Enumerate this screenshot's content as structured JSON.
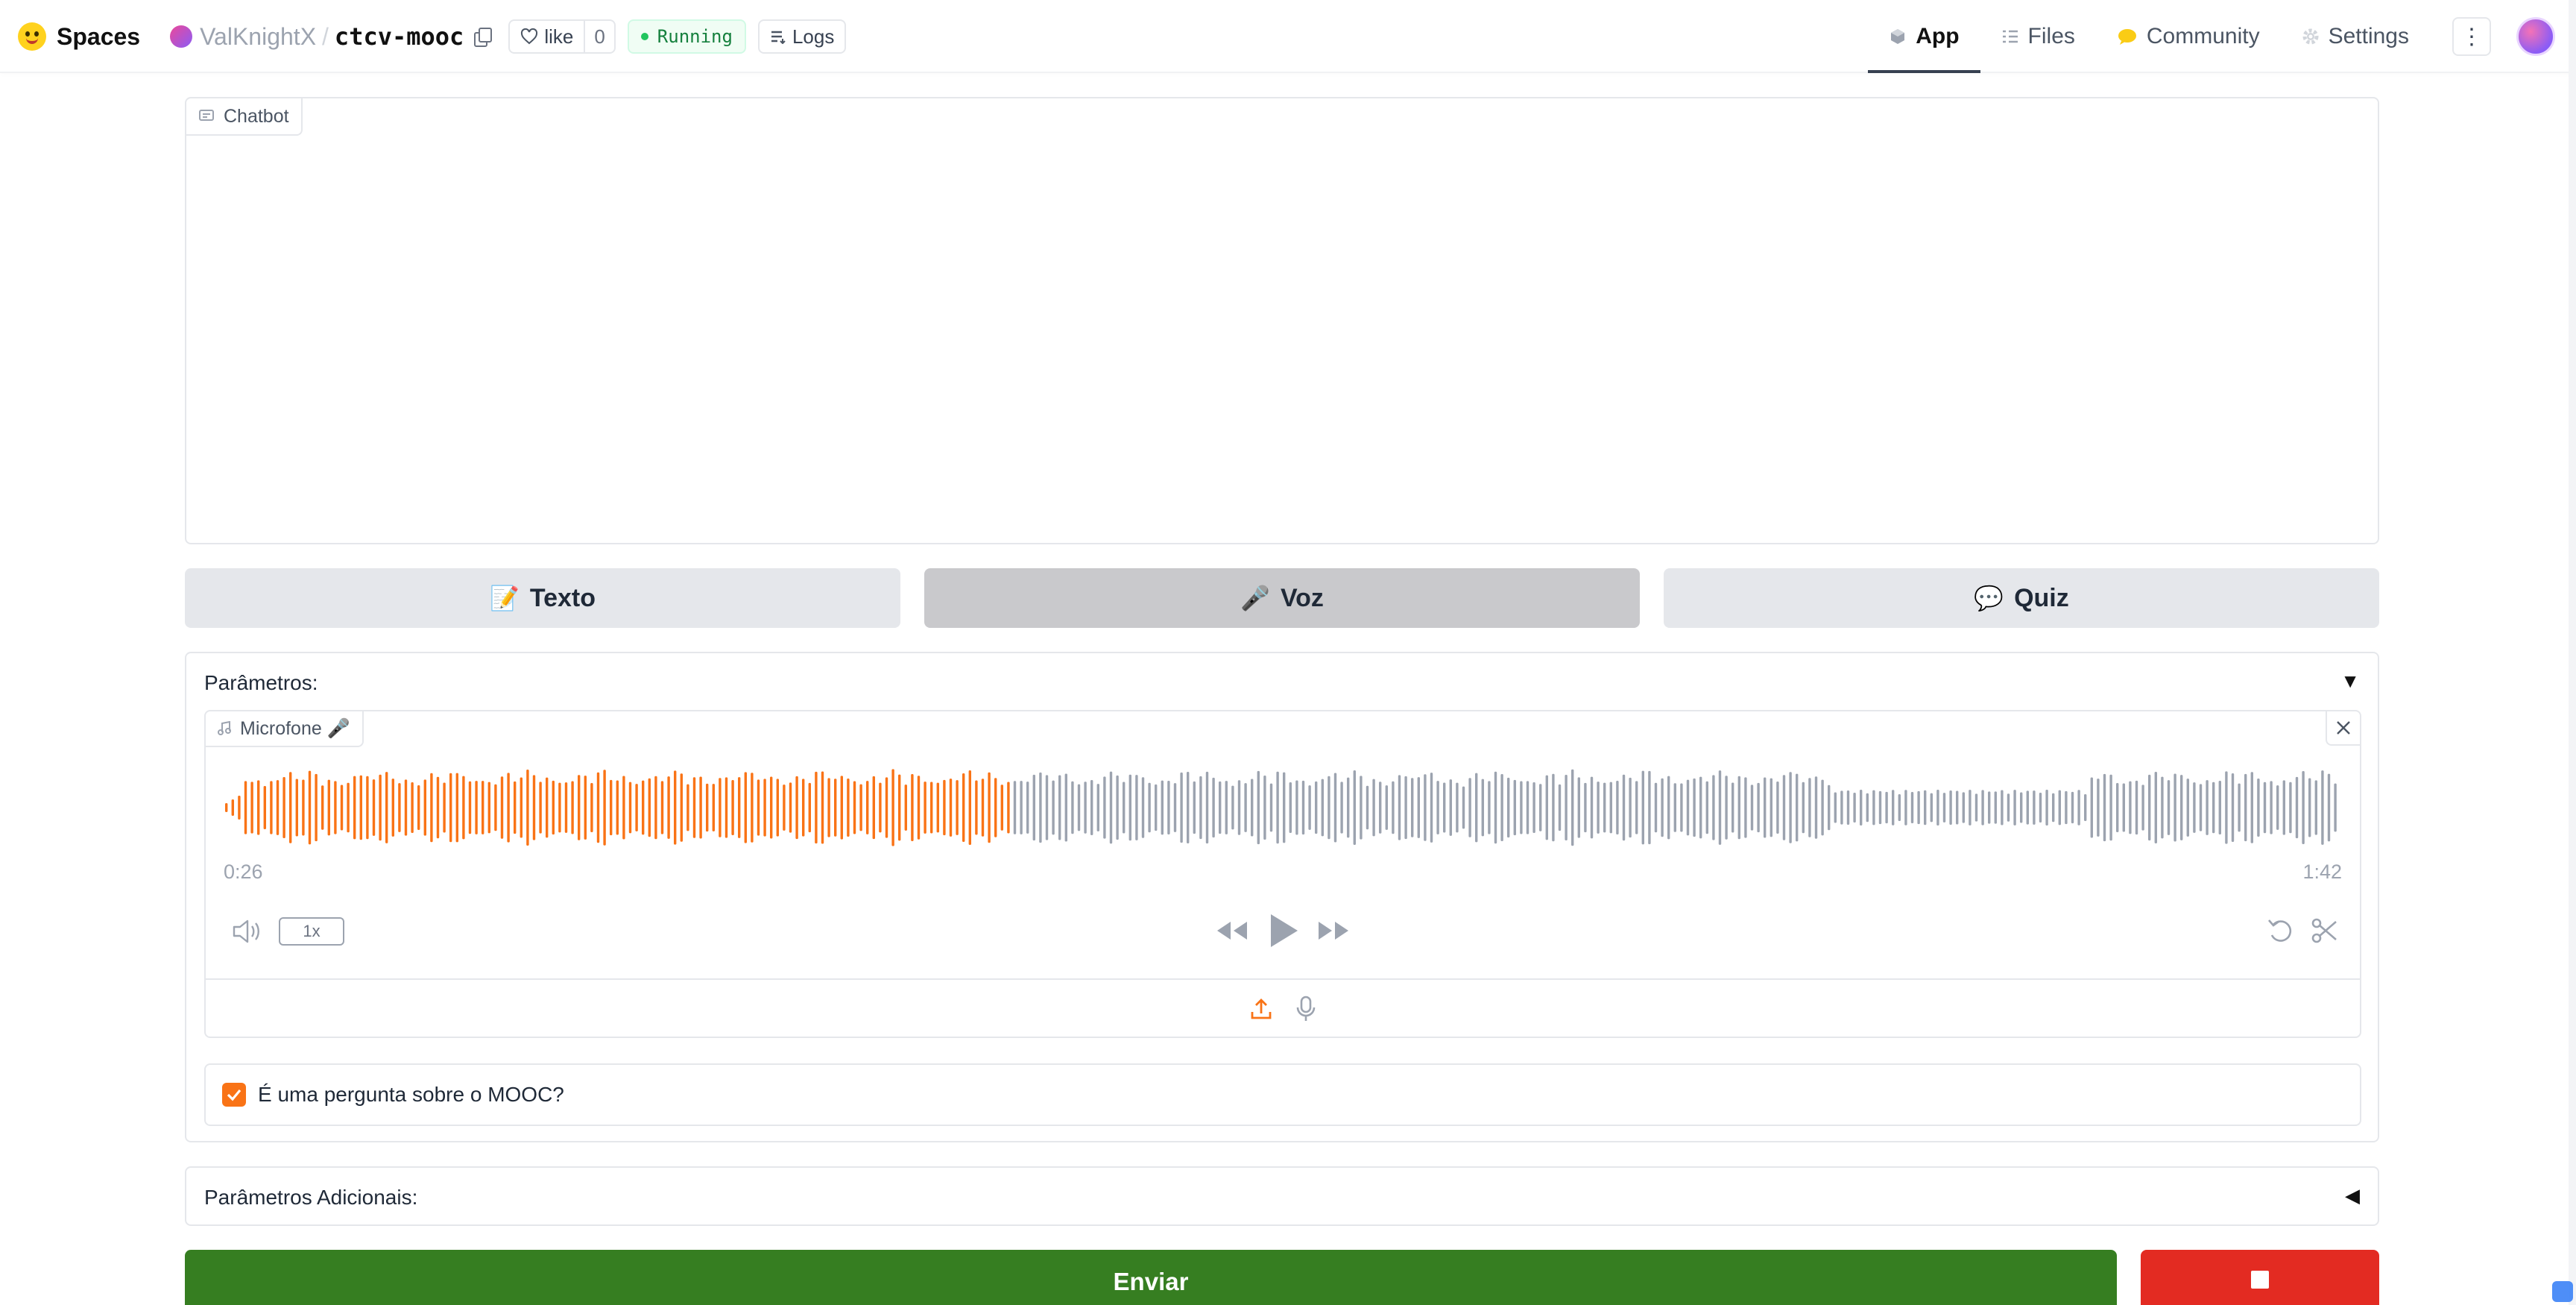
{
  "header": {
    "brand": "Spaces",
    "owner": "ValKnightX",
    "separator": "/",
    "repo": "ctcv-mooc",
    "like_label": "like",
    "like_count": "0",
    "status": "Running",
    "logs_label": "Logs",
    "nav": [
      {
        "label": "App",
        "icon": "app-cube-icon",
        "active": true
      },
      {
        "label": "Files",
        "icon": "files-icon",
        "active": false
      },
      {
        "label": "Community",
        "icon": "community-icon",
        "active": false
      },
      {
        "label": "Settings",
        "icon": "gear-icon",
        "active": false
      }
    ]
  },
  "chatbot": {
    "label": "Chatbot"
  },
  "modes": [
    {
      "emoji": "📝",
      "label": "Texto",
      "selected": false
    },
    {
      "emoji": "🎤",
      "label": "Voz",
      "selected": true
    },
    {
      "emoji": "💬",
      "label": "Quiz",
      "selected": false
    }
  ],
  "params": {
    "title": "Parâmetros:",
    "arrow": "▼",
    "audio": {
      "label": "Microfone 🎤",
      "current_time": "0:26",
      "total_time": "1:42",
      "speed": "1x",
      "played_fraction": 0.37,
      "played_color": "#f97316",
      "unplayed_color": "#9ca3af"
    },
    "checkbox": {
      "label": "É uma pergunta sobre o MOOC?",
      "checked": true
    }
  },
  "params_extra": {
    "title": "Parâmetros Adicionais:",
    "arrow": "◀"
  },
  "actions": {
    "submit": "Enviar",
    "stop_icon": "stop-square-icon"
  },
  "colors": {
    "accent": "#f97316",
    "submit": "#367e21",
    "stop": "#e32b22",
    "running": "#15803d"
  }
}
